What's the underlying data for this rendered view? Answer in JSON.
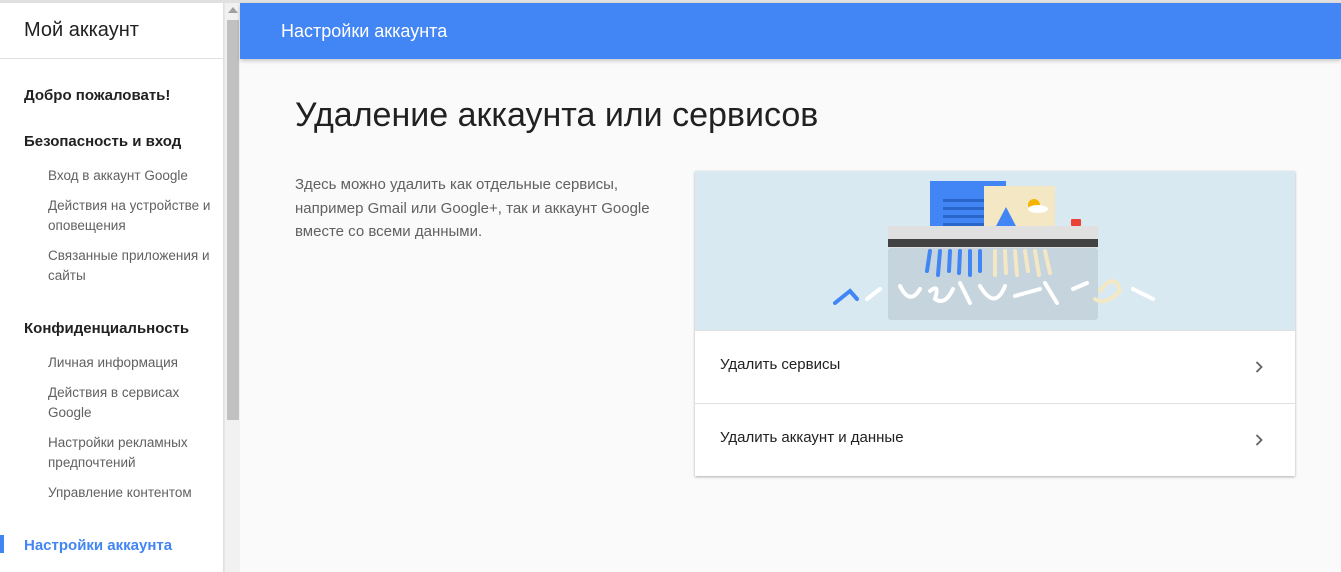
{
  "sidebar": {
    "title": "Мой аккаунт",
    "welcome": "Добро пожаловать!",
    "security": {
      "heading": "Безопасность и вход",
      "items": [
        "Вход в аккаунт Google",
        "Действия на устройстве и оповещения",
        "Связанные приложения и сайты"
      ]
    },
    "privacy": {
      "heading": "Конфиденциальность",
      "items": [
        "Личная информация",
        "Действия в сервисах Google",
        "Настройки рекламных предпочтений",
        "Управление контентом"
      ]
    },
    "account_settings": "Настройки аккаунта"
  },
  "header": {
    "title": "Настройки аккаунта"
  },
  "main": {
    "title": "Удаление аккаунта или сервисов",
    "description": "Здесь можно удалить как отдельные сервисы, например Gmail или Google+, так и аккаунт Google вместе со всеми данными.",
    "actions": [
      {
        "label": "Удалить сервисы",
        "icon": "chevron-right-icon"
      },
      {
        "label": "Удалить аккаунт и данные",
        "icon": "chevron-right-icon"
      }
    ],
    "illustration": "shredder-illustration"
  },
  "colors": {
    "accent": "#4285f4",
    "illustration_bg": "#d8e9f2"
  }
}
